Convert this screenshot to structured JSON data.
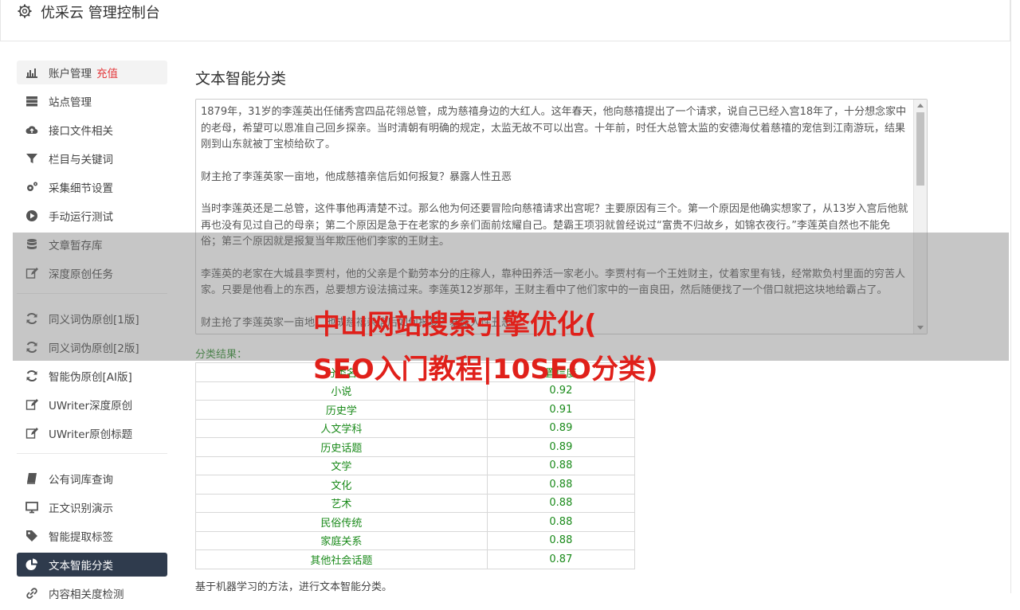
{
  "header": {
    "title": "优采云 管理控制台"
  },
  "sidebar": {
    "groups": [
      [
        {
          "label": "账户管理",
          "extra": "充值",
          "icon": "bar-chart-icon",
          "state": "light"
        },
        {
          "label": "站点管理",
          "icon": "server-icon"
        },
        {
          "label": "接口文件相关",
          "icon": "cloud-upload-icon"
        },
        {
          "label": "栏目与关键词",
          "icon": "filter-icon"
        },
        {
          "label": "采集细节设置",
          "icon": "gears-icon"
        },
        {
          "label": "手动运行测试",
          "icon": "play-circle-icon"
        },
        {
          "label": "文章暂存库",
          "icon": "database-icon"
        },
        {
          "label": "深度原创任务",
          "icon": "edit-icon"
        }
      ],
      [
        {
          "label": "同义词伪原创[1版]",
          "icon": "refresh-icon"
        },
        {
          "label": "同义词伪原创[2版]",
          "icon": "refresh-icon"
        },
        {
          "label": "智能伪原创[AI版]",
          "icon": "refresh-icon"
        },
        {
          "label": "UWriter深度原创",
          "icon": "edit-icon"
        },
        {
          "label": "UWriter原创标题",
          "icon": "edit-icon"
        }
      ],
      [
        {
          "label": "公有词库查询",
          "icon": "book-icon"
        },
        {
          "label": "正文识别演示",
          "icon": "monitor-icon"
        },
        {
          "label": "智能提取标签",
          "icon": "tag-icon"
        },
        {
          "label": "文本智能分类",
          "icon": "pie-chart-icon",
          "state": "active"
        },
        {
          "label": "内容相关度检测",
          "icon": "link-icon"
        }
      ]
    ]
  },
  "main": {
    "title": "文本智能分类",
    "text_paragraphs": [
      "1879年，31岁的李莲英出任储秀宫四品花翎总管，成为慈禧身边的大红人。这年春天，他向慈禧提出了一个请求，说自己已经入宫18年了，十分想念家中的老母，希望可以恩准自己回乡探亲。当时清朝有明确的规定，太监无故不可以出宫。十年前，时任大总管太监的安德海仗着慈禧的宠信到江南游玩，结果刚到山东就被丁宝桢给砍了。",
      "财主抢了李莲英家一亩地，他成慈禧亲信后如何报复？暴露人性丑恶",
      "当时李莲英还是二总管，这件事他再清楚不过。那么他为何还要冒险向慈禧请求出宫呢？主要原因有三个。第一个原因是他确实想家了，从13岁入宫后他就再也没有见过自己的母亲；第二个原因是急于在老家的乡亲们面前炫耀自己。楚霸王项羽就曾经说过“富贵不归故乡，如锦衣夜行。”李莲英自然也不能免俗；第三个原因就是报复当年欺压他们李家的王财主。",
      "李莲英的老家在大城县李贾村，他的父亲是个勤劳本分的庄稼人，靠种田养活一家老小。李贾村有一个王姓财主，仗着家里有钱，经常欺负村里面的穷苦人家。只要是他看上的东西，总要想方设法搞过来。李莲英12岁那年，王财主看中了他们家中的一亩良田，然后随便找了一个借口就把这块地给霸占了。",
      "财主抢了李莲英家一亩地，他成慈禧亲信后如何报复？暴露人性丑恶"
    ],
    "result_label": "分类结果：",
    "table": {
      "headers": [
        "分类名",
        "置信度"
      ],
      "rows": [
        [
          "小说",
          "0.92"
        ],
        [
          "历史学",
          "0.91"
        ],
        [
          "人文学科",
          "0.89"
        ],
        [
          "历史话题",
          "0.89"
        ],
        [
          "文学",
          "0.88"
        ],
        [
          "文化",
          "0.88"
        ],
        [
          "艺术",
          "0.88"
        ],
        [
          "民俗传统",
          "0.88"
        ],
        [
          "家庭关系",
          "0.88"
        ],
        [
          "其他社会话题",
          "0.87"
        ]
      ]
    },
    "description": "基于机器学习的方法，进行文本智能分类。"
  },
  "watermark": {
    "line1": "中山网站搜索引擎优化(",
    "line2": "SEO入门教程|10SEO分类)"
  },
  "colors": {
    "accent_red": "#e4393c",
    "active_nav": "#2f3b4d",
    "result_green": "#1a8a1a",
    "watermark": "#e0201a"
  }
}
